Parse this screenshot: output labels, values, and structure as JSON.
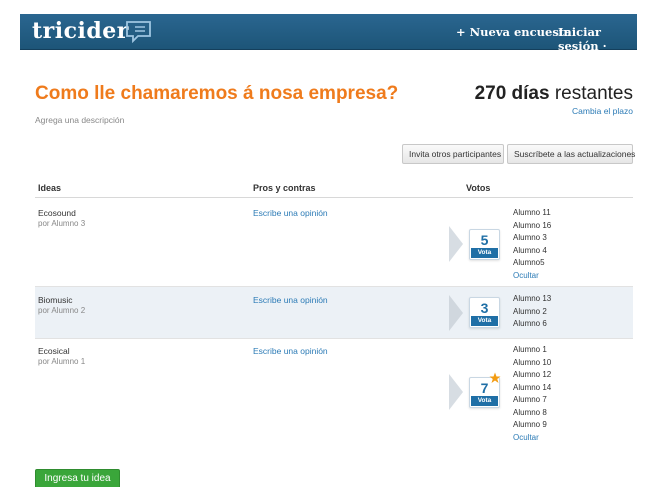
{
  "header": {
    "logo_text": "tricider",
    "nav_new": "+ Nueva encuesta",
    "nav_login": "Iniciar sesión ·"
  },
  "poll": {
    "title": "Como lle chamaremos á nosa empresa?",
    "description": "Agrega una descripción",
    "days_number": "270 días",
    "days_suffix": " restantes",
    "change_deadline": "Cambia el plazo"
  },
  "actions": {
    "invite": "Invita otros participantes",
    "subscribe": "Suscríbete a las actualizaciones"
  },
  "table": {
    "headers": {
      "ideas": "Ideas",
      "pros": "Pros y contras",
      "votes": "Votos"
    },
    "rows": [
      {
        "name": "Ecosound",
        "author": "por Alumno 3",
        "opinion": "Escribe una opinión",
        "votes": "5",
        "vote_label": "Vota",
        "voters": [
          "Alumno 11",
          "Alumno 16",
          "Alumno 3",
          "Alumno 4",
          "Alumno5"
        ],
        "hide": "Ocultar"
      },
      {
        "name": "Biomusic",
        "author": "por Alumno 2",
        "opinion": "Escribe una opinión",
        "votes": "3",
        "vote_label": "Vota",
        "voters": [
          "Alumno 13",
          "Alumno 2",
          "Alumno 6"
        ]
      },
      {
        "name": "Ecosical",
        "author": "por Alumno 1",
        "opinion": "Escribe una opinión",
        "votes": "7",
        "vote_label": "Vota",
        "voters": [
          "Alumno 1",
          "Alumno 10",
          "Alumno 12",
          "Alumno 14",
          "Alumno 7",
          "Alumno 8",
          "Alumno 9"
        ],
        "hide": "Ocultar"
      }
    ]
  },
  "footer": {
    "submit_idea": "Ingresa tu idea"
  },
  "colors": {
    "title_orange": "#ef7b1c",
    "header_blue": "#2a6690",
    "link_blue": "#2c7bb6",
    "vote_blue": "#1f6fa6",
    "star_orange": "#f39c12",
    "submit_green": "#3aa63a"
  },
  "icons": {
    "logo": "speech-bubble-icon",
    "star": "star-icon",
    "arrow": "chevron-right-icon"
  }
}
